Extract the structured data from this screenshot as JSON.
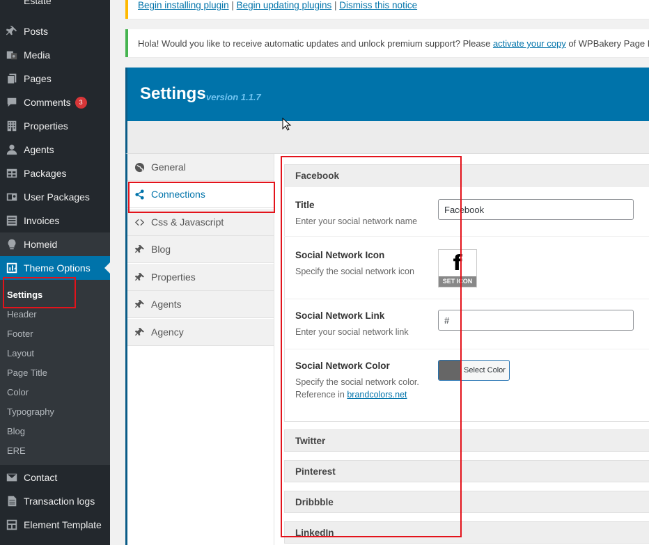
{
  "sidebar": {
    "top_partial": "Estate",
    "items": [
      {
        "label": "Posts",
        "icon": "pin-icon"
      },
      {
        "label": "Media",
        "icon": "media-icon"
      },
      {
        "label": "Pages",
        "icon": "pages-icon"
      },
      {
        "label": "Comments",
        "icon": "comments-icon",
        "badge": "3"
      },
      {
        "label": "Properties",
        "icon": "building-icon"
      },
      {
        "label": "Agents",
        "icon": "person-icon"
      },
      {
        "label": "Packages",
        "icon": "table-icon"
      },
      {
        "label": "User Packages",
        "icon": "user-package-icon"
      },
      {
        "label": "Invoices",
        "icon": "list-icon"
      },
      {
        "label": "Homeid",
        "icon": "lightbulb-icon"
      },
      {
        "label": "Theme Options",
        "icon": "theme-options-icon"
      },
      {
        "label": "Contact",
        "icon": "mail-icon"
      },
      {
        "label": "Transaction logs",
        "icon": "document-icon"
      },
      {
        "label": "Element Template",
        "icon": "grid-icon"
      }
    ],
    "submenu": [
      "Settings",
      "Header",
      "Footer",
      "Layout",
      "Page Title",
      "Color",
      "Typography",
      "Blog",
      "ERE"
    ]
  },
  "notices": {
    "plugins": {
      "link1": "Begin installing plugin",
      "sep": "|",
      "link2": "Begin updating plugins",
      "link3": "Dismiss this notice"
    },
    "wpbakery": {
      "text_before": "Hola! Would you like to receive automatic updates and unlock premium support? Please ",
      "link": "activate your copy",
      "text_after": " of WPBakery Page Bu"
    }
  },
  "settings": {
    "title": "Settings",
    "version": "version 1.1.7",
    "tabs": [
      {
        "label": "General",
        "icon": "globe-icon"
      },
      {
        "label": "Connections",
        "icon": "share-icon"
      },
      {
        "label": "Css & Javascript",
        "icon": "code-icon"
      },
      {
        "label": "Blog",
        "icon": "pin-icon"
      },
      {
        "label": "Properties",
        "icon": "pin-icon"
      },
      {
        "label": "Agents",
        "icon": "pin-icon"
      },
      {
        "label": "Agency",
        "icon": "pin-icon"
      }
    ]
  },
  "connections": {
    "groups": [
      "Facebook",
      "Twitter",
      "Pinterest",
      "Dribbble",
      "LinkedIn"
    ],
    "fields": {
      "title_label": "Title",
      "title_desc": "Enter your social network name",
      "title_value": "Facebook",
      "icon_label": "Social Network Icon",
      "icon_desc": "Specify the social network icon",
      "icon_glyph": "f",
      "icon_button": "SET ICON",
      "link_label": "Social Network Link",
      "link_desc": "Enter your social network link",
      "link_value": "#",
      "color_label": "Social Network Color",
      "color_desc1": "Specify the social network color.",
      "color_desc2_prefix": "Reference in ",
      "color_desc2_link": "brandcolors.net",
      "color_button": "Select Color",
      "color_value": "#666666"
    }
  },
  "colors": {
    "sidebar_bg": "#23282d",
    "accent": "#0073aa",
    "highlight": "#e3131b"
  }
}
